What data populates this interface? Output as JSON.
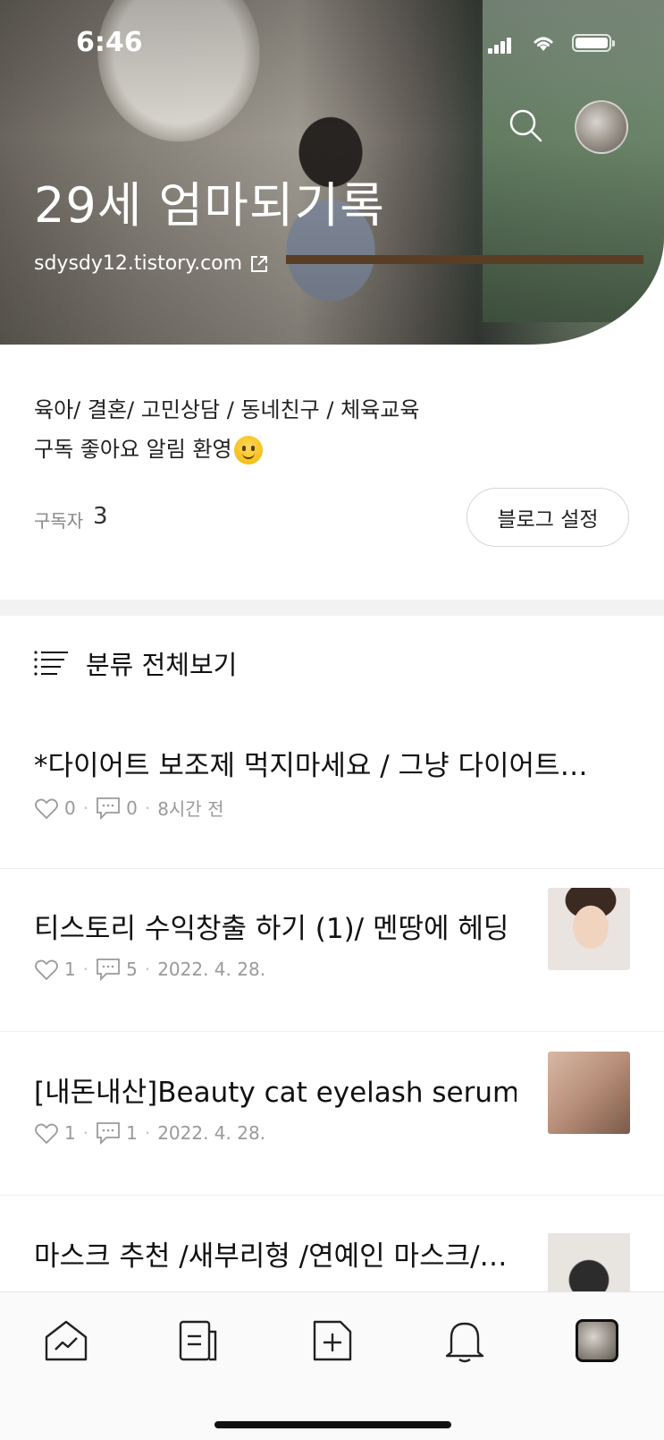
{
  "status_bar": {
    "time": "6:46"
  },
  "header": {
    "title": "29세 엄마되기록",
    "url": "sdysdy12.tistory.com"
  },
  "profile": {
    "description_line1": "육아/ 결혼/ 고민상담 / 동네친구 / 체육교육",
    "description_line2": "구독 좋아요 알림 환영",
    "subscribers_label": "구독자",
    "subscribers_count": "3",
    "settings_button": "블로그 설정"
  },
  "category": {
    "label": "분류 전체보기"
  },
  "posts": [
    {
      "title": "*다이어트 보조제 먹지마세요 / 그냥 다이어트…",
      "likes": "0",
      "comments": "0",
      "date": "8시간 전",
      "has_thumb": false
    },
    {
      "title": "티스토리 수익창출 하기 (1)/ 멘땅에 헤딩",
      "likes": "1",
      "comments": "5",
      "date": "2022. 4. 28.",
      "has_thumb": true,
      "thumb_color": "#d9b59c"
    },
    {
      "title": "[내돈내산]Beauty cat eyelash serum…",
      "likes": "1",
      "comments": "1",
      "date": "2022. 4. 28.",
      "has_thumb": true,
      "thumb_color": "#b58a72"
    },
    {
      "title": "마스크 추천 /새부리형 /연예인 마스크/…",
      "likes": "",
      "comments": "",
      "date": "",
      "has_thumb": true,
      "thumb_color": "#e3e0dc"
    }
  ],
  "tabbar": {
    "items": [
      "home-chart-icon",
      "document-icon",
      "new-post-icon",
      "bell-icon",
      "profile-tab-avatar"
    ]
  }
}
